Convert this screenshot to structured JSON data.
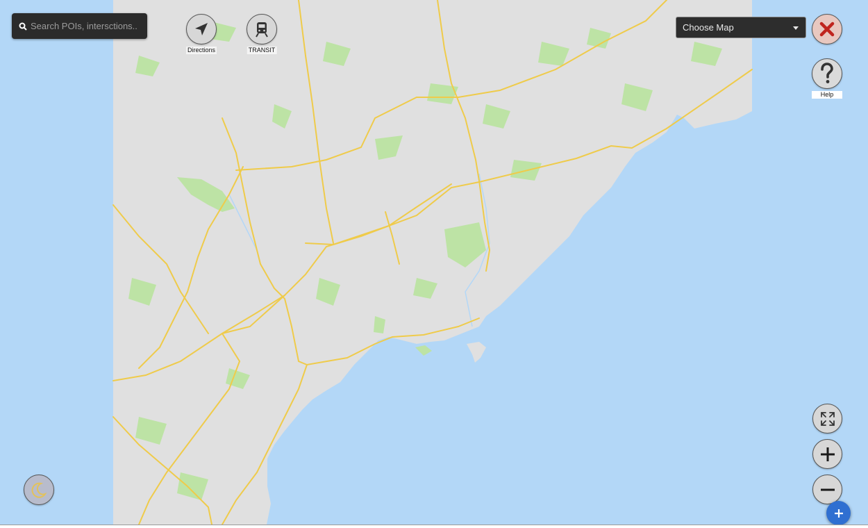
{
  "search": {
    "placeholder": "Search POIs, intersctions.."
  },
  "toolbar": {
    "directions_label": "Directions",
    "transit_label": "TRANSIT",
    "help_label": "Help"
  },
  "map_select": {
    "selected": "Choose Map"
  },
  "icons": {
    "search": "search-icon",
    "directions": "navigation-arrow-icon",
    "transit": "train-icon",
    "close": "close-icon",
    "help": "question-mark-icon",
    "fullscreen": "expand-icon",
    "zoom_in": "plus-icon",
    "zoom_out": "minus-icon",
    "night_mode": "moon-icon",
    "add": "add-icon"
  },
  "colors": {
    "water": "#b3d7f7",
    "land": "#e0e0e0",
    "park": "#bde3a5",
    "highway": "#efcb4a",
    "close_x": "#c0251e",
    "fab": "#2f6fd1"
  }
}
